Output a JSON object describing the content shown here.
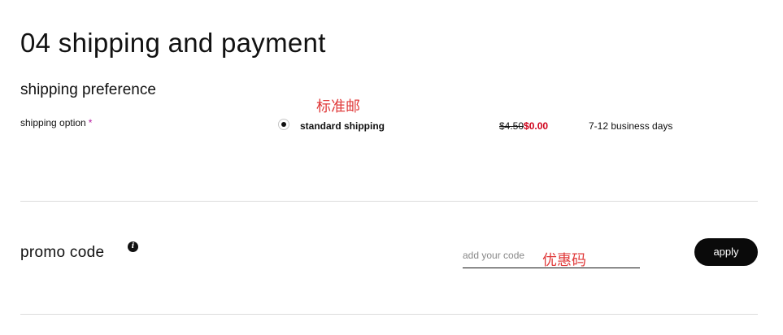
{
  "page": {
    "title": "04 shipping and payment"
  },
  "shipping": {
    "section_title": "shipping preference",
    "option_label": "shipping option",
    "required_marker": "*",
    "annotation": "标准邮",
    "selected_option": {
      "name": "standard shipping",
      "selected": true,
      "old_price": "$4.50",
      "new_price": "$0.00",
      "delivery_time": "7-12 business days"
    }
  },
  "promo": {
    "title": "promo code",
    "info_icon": "info-icon",
    "input_placeholder": "add your code",
    "input_value": "",
    "annotation": "优惠码",
    "apply_label": "apply"
  },
  "colors": {
    "accent_price": "#d0021b",
    "annotation": "#e03b3b",
    "button_bg": "#0a0a0a",
    "required_star": "#b5179e"
  }
}
